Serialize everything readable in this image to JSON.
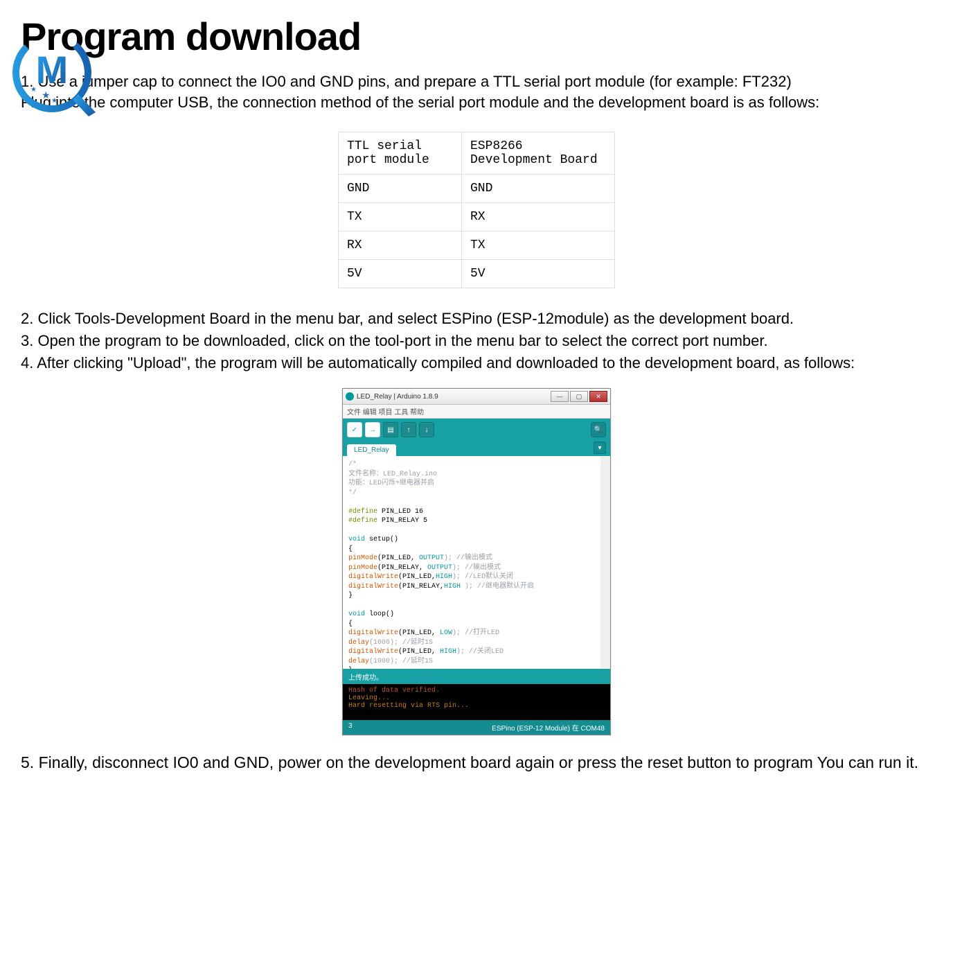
{
  "title": "Program download",
  "logo_letter": "M",
  "intro": {
    "line1": "1. Use a jumper cap to connect the IO0 and GND pins, and prepare a TTL serial port module (for example: FT232)",
    "line2": "Plug into the computer USB, the connection method of the serial port module and the development board is as follows:"
  },
  "pin_table": {
    "header_left": "TTL serial port module",
    "header_right": "ESP8266 Development Board",
    "rows": [
      {
        "l": "GND",
        "r": "GND"
      },
      {
        "l": "TX",
        "r": "RX"
      },
      {
        "l": "RX",
        "r": "TX"
      },
      {
        "l": "5V",
        "r": "5V"
      }
    ]
  },
  "steps": {
    "s2": "2. Click Tools-Development Board in the menu bar, and select ESPino (ESP-12module) as the development board.",
    "s3": "3. Open the program to be downloaded, click on the tool-port in the menu bar to select the correct port number.",
    "s4": "4. After clicking \"Upload\", the program will be automatically compiled and downloaded to the development board, as follows:"
  },
  "ide": {
    "title": "LED_Relay | Arduino 1.8.9",
    "menus": "文件  编辑  项目  工具  帮助",
    "tab": "LED_Relay",
    "status": "上传成功。",
    "console_line1": "Hash of data verified.",
    "console_line2": "Leaving...",
    "console_line3": "Hard resetting via RTS pin...",
    "bottom_line": "3",
    "bottom_board": "ESPino (ESP-12 Module) 在 COM48",
    "code": {
      "c1": "/*",
      "c2": "  文件名称：LED_Relay.ino",
      "c3": "  功能：LED闪烁+继电器并启",
      "c4": "*/",
      "d1a": "#define",
      "d1b": " PIN_LED   16",
      "d2a": "#define",
      "d2b": " PIN_RELAY 5",
      "s1a": "void",
      "s1b": " setup()",
      "br1": "{",
      "p1a": "  pinMode",
      "p1b": "(PIN_LED, ",
      "p1c": "OUTPUT",
      "p1d": ");      //输出模式",
      "p2a": "  pinMode",
      "p2b": "(PIN_RELAY, ",
      "p2c": "OUTPUT",
      "p2d": ");    //输出模式",
      "p3a": "  digitalWrite",
      "p3b": "(PIN_LED,",
      "p3c": "HIGH",
      "p3d": ");   //LED默认关闭",
      "p4a": "  digitalWrite",
      "p4b": "(PIN_RELAY,",
      "p4c": "HIGH",
      "p4d": " ); //继电器默认开启",
      "br2": "}",
      "l1a": "void",
      "l1b": " loop()",
      "br3": "{",
      "q1a": "   digitalWrite",
      "q1b": "(PIN_LED, ",
      "q1c": "LOW",
      "q1d": ");   //打开LED",
      "q2a": "   delay",
      "q2b": "(1000); //延时1S",
      "q3a": "   digitalWrite",
      "q3b": "(PIN_LED, ",
      "q3c": "HIGH",
      "q3d": ");  //关闭LED",
      "q4a": "   delay",
      "q4b": "(1000); //延时1S",
      "br4": "}"
    }
  },
  "final": "5. Finally, disconnect IO0 and GND, power on the development board again or press the reset button to program You can run it."
}
